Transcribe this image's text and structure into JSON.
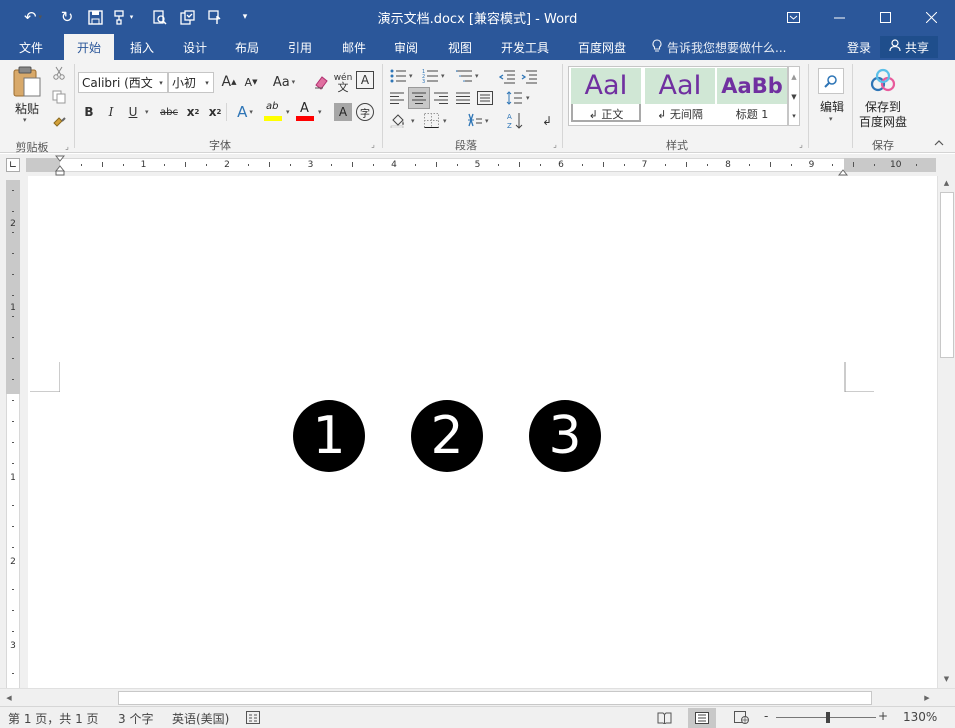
{
  "titlebar": {
    "title": "演示文档.docx [兼容模式] - Word",
    "quick_access": {
      "save_icon": "save-icon",
      "undo_icon": "undo-icon",
      "redo_icon": "redo-icon"
    }
  },
  "tabs": [
    "文件",
    "开始",
    "插入",
    "设计",
    "布局",
    "引用",
    "邮件",
    "审阅",
    "视图",
    "开发工具",
    "百度网盘"
  ],
  "active_tab": "开始",
  "tell_me": "告诉我您想要做什么...",
  "login": "登录",
  "share": "共享",
  "ribbon": {
    "clipboard": {
      "paste": "粘贴",
      "label": "剪贴板"
    },
    "font": {
      "name": "Calibri (西文",
      "size": "小初",
      "label": "字体",
      "wen": "wén",
      "wen_char": "文",
      "bold": "B",
      "italic": "I",
      "underline": "U",
      "strike": "abc",
      "sub": "x",
      "sup": "x",
      "sub_mark": "2",
      "sup_mark": "2",
      "grow": "A",
      "shrink": "A",
      "case": "Aa",
      "text_border": "A",
      "shade": "A",
      "enclose": "字",
      "effects": "A",
      "highlight": "ab",
      "font_color": "A"
    },
    "paragraph": {
      "label": "段落"
    },
    "styles": {
      "label": "样式",
      "items": [
        {
          "preview": "AaI",
          "name": "正文"
        },
        {
          "preview": "AaI",
          "name": "无间隔"
        },
        {
          "preview": "AaBb",
          "name": "标题 1"
        }
      ],
      "para_mark": "↲"
    },
    "editing": {
      "label": "编辑"
    },
    "save": {
      "label_line1": "保存到",
      "label_line2": "百度网盘",
      "group": "保存"
    }
  },
  "ruler": {
    "h_numbers": [
      "2",
      "1",
      "1",
      "2",
      "3",
      "4",
      "5",
      "6",
      "7",
      "8",
      "9",
      "10"
    ],
    "v_numbers": [
      "2",
      "1",
      "1",
      "2",
      "3"
    ]
  },
  "document": {
    "numbers": [
      "1",
      "2",
      "3"
    ]
  },
  "status": {
    "page": "第 1 页，共 1 页",
    "words": "3 个字",
    "lang": "英语(美国)",
    "zoom": "130%",
    "minus": "-",
    "plus": "+"
  },
  "colors": {
    "accent": "#2b579a",
    "style_purple": "#7030a0",
    "highlight": "#ffff00",
    "font_red": "#ff0000"
  }
}
